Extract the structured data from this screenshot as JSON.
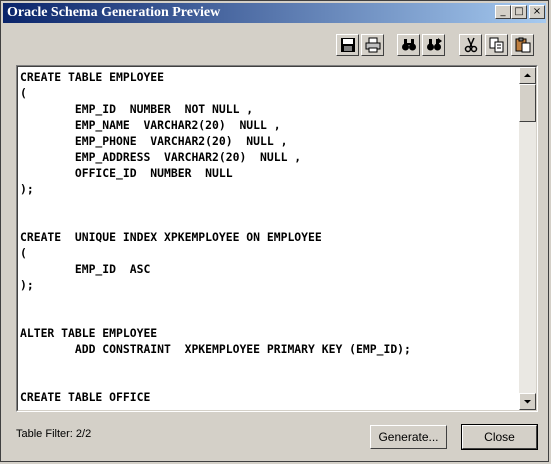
{
  "window": {
    "title": "Oracle Schema Generation Preview"
  },
  "title_buttons": {
    "minimize": "_",
    "maximize": "□",
    "close": "×"
  },
  "toolbar": [
    {
      "name": "save-icon"
    },
    {
      "name": "print-icon"
    },
    {
      "name": "find-icon"
    },
    {
      "name": "find-next-icon"
    },
    {
      "name": "cut-icon"
    },
    {
      "name": "copy-icon"
    },
    {
      "name": "paste-icon"
    }
  ],
  "editor": {
    "lines": [
      "CREATE TABLE EMPLOYEE",
      "(",
      "        EMP_ID  NUMBER  NOT NULL ,",
      "        EMP_NAME  VARCHAR2(20)  NULL ,",
      "        EMP_PHONE  VARCHAR2(20)  NULL ,",
      "        EMP_ADDRESS  VARCHAR2(20)  NULL ,",
      "        OFFICE_ID  NUMBER  NULL",
      ");",
      "",
      "",
      "CREATE  UNIQUE INDEX XPKEMPLOYEE ON EMPLOYEE",
      "(",
      "        EMP_ID  ASC",
      ");",
      "",
      "",
      "ALTER TABLE EMPLOYEE",
      "        ADD CONSTRAINT  XPKEMPLOYEE PRIMARY KEY (EMP_ID);",
      "",
      "",
      "CREATE TABLE OFFICE"
    ]
  },
  "status": {
    "table_filter": "Table Filter: 2/2"
  },
  "buttons": {
    "generate": "Generate...",
    "close": "Close"
  }
}
